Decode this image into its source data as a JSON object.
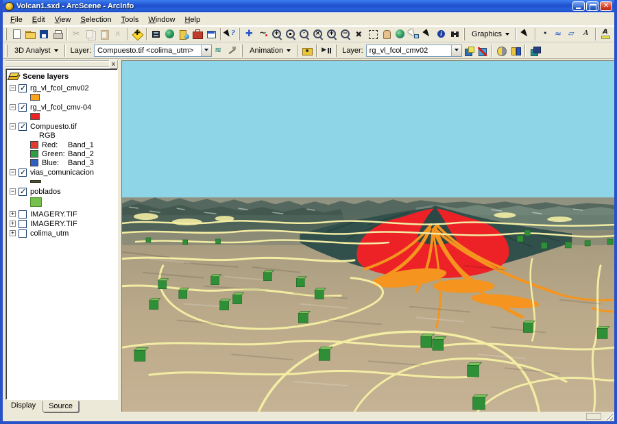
{
  "window": {
    "title": "Volcan1.sxd - ArcScene - ArcInfo"
  },
  "menu": {
    "items": [
      "File",
      "Edit",
      "View",
      "Selection",
      "Tools",
      "Window",
      "Help"
    ]
  },
  "toolbars": {
    "standard": {
      "icons": [
        "new",
        "open",
        "save",
        "print",
        "cut",
        "copy",
        "paste",
        "delete",
        "add-data",
        "export",
        "arcmap",
        "arccatalog",
        "arctoolbox",
        "new-window",
        "whats-this"
      ]
    },
    "navigation": {
      "icons": [
        "navigate",
        "fly",
        "zoom-target",
        "center-target",
        "observer",
        "target-observer",
        "zoom-in",
        "zoom-out",
        "full-extent",
        "zoom-extents",
        "pan",
        "globe-view",
        "select-graphics",
        "pointer",
        "identify",
        "find"
      ]
    },
    "graphics": {
      "label": "Graphics",
      "icons": [
        "select-elements",
        "new-marker",
        "new-line",
        "new-polygon",
        "new-text",
        "font-color",
        "fill-color",
        "line-color",
        "marker-color"
      ]
    },
    "analyst": {
      "label": "3D Analyst",
      "layer_label": "Layer:",
      "layer_value": "Compuesto.tif <colima_utm>",
      "icons": [
        "surface-analysis",
        "interpolate-line"
      ]
    },
    "animation": {
      "label": "Animation",
      "icons": [
        "camera",
        "animation-controls"
      ]
    },
    "scene_layer": {
      "layer_label": "Layer:",
      "layer_value": "rg_vl_fcol_cmv02",
      "icons": [
        "base-heights",
        "remove-base-heights",
        "sun-position",
        "viewer-settings",
        "scene-properties"
      ]
    }
  },
  "toc": {
    "header": "Scene layers",
    "layers": [
      {
        "name": "rg_vl_fcol_cmv02",
        "checked": true,
        "swatch_color": "#FFA41C"
      },
      {
        "name": "rg_vl_fcol_cmv-04",
        "checked": true,
        "swatch_color": "#ED2024"
      },
      {
        "name": "Compuesto.tif",
        "checked": true,
        "sub_label": "RGB",
        "bands": [
          {
            "label": "Red:",
            "band": "Band_1",
            "color": "#E13B2F"
          },
          {
            "label": "Green:",
            "band": "Band_2",
            "color": "#2F9E41"
          },
          {
            "label": "Blue:",
            "band": "Band_3",
            "color": "#2F5FC0"
          }
        ]
      },
      {
        "name": "vias_comunicacion",
        "checked": true,
        "swatch_color": "#4F5243"
      },
      {
        "name": "poblados",
        "checked": true,
        "swatch_color": "#76C14E"
      },
      {
        "name": "IMAGERY.TIF",
        "checked": false
      },
      {
        "name": "IMAGERY.TIF",
        "checked": false
      },
      {
        "name": "colima_utm",
        "checked": false
      }
    ],
    "tabs": [
      {
        "label": "Display"
      },
      {
        "label": "Source"
      }
    ]
  },
  "scene": {
    "colors": {
      "sky": "#8ED5E8",
      "terrain_tan": "#C0AE8E",
      "mountain_teal": "#33504B",
      "hazard_red": "#EC2227",
      "lava_flow_orange": "#F5941E",
      "roads_yellow": "#F3EDA4",
      "towns_green": "#2F8F36"
    }
  }
}
